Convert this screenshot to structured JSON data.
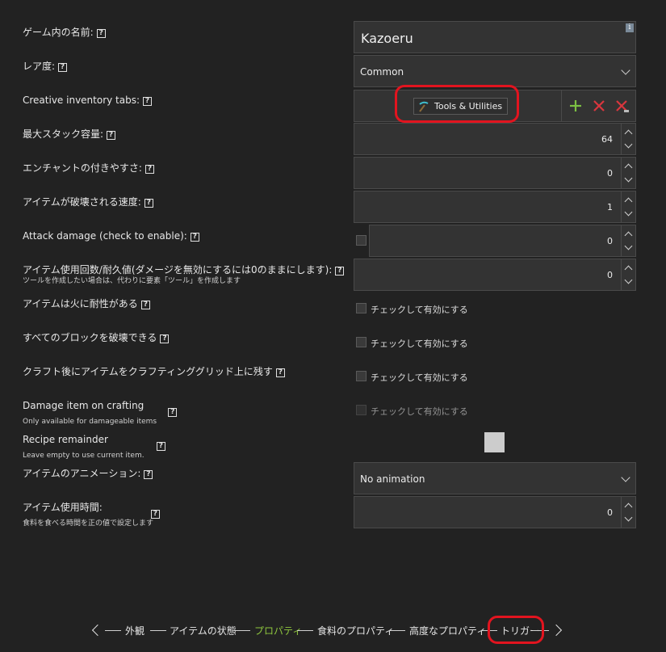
{
  "fields": {
    "name": {
      "label": "ゲーム内の名前:",
      "value": "Kazoeru",
      "info": "i"
    },
    "rarity": {
      "label": "レア度:",
      "value": "Common"
    },
    "creative_tabs": {
      "label": "Creative inventory tabs:",
      "tab": "Tools & Utilities"
    },
    "max_stack": {
      "label": "最大スタック容量:",
      "value": "64"
    },
    "enchantability": {
      "label": "エンチャントの付きやすさ:",
      "value": "0"
    },
    "destroy_speed": {
      "label": "アイテムが破壊される速度:",
      "value": "1"
    },
    "attack_damage": {
      "label": "Attack damage (check to enable):",
      "value": "0"
    },
    "durability": {
      "label": "アイテム使用回数/耐久値(ダメージを無効にするには0のままにします):",
      "sub": "ツールを作成したい場合は、代わりに要素「ツール」を作成します",
      "value": "0"
    },
    "fire_resistant": {
      "label": "アイテムは火に耐性がある",
      "check_text": "チェックして有効にする"
    },
    "destroy_any_block": {
      "label": "すべてのブロックを破壊できる",
      "check_text": "チェックして有効にする"
    },
    "stay_in_grid": {
      "label": "クラフト後にアイテムをクラフティンググリッド上に残す",
      "check_text": "チェックして有効にする"
    },
    "damage_on_crafting": {
      "label": "Damage item on crafting",
      "sub": "Only available for damageable items",
      "check_text": "チェックして有効にする"
    },
    "recipe_remainder": {
      "label": "Recipe remainder",
      "sub": "Leave empty to use current item."
    },
    "animation": {
      "label": "アイテムのアニメーション:",
      "value": "No animation"
    },
    "use_duration": {
      "label": "アイテム使用時間:",
      "sub": "食料を食べる時間を正の値で設定します",
      "value": "0"
    }
  },
  "help_mark": "?",
  "nav": {
    "items": [
      "外観",
      "アイテムの状態",
      "プロパティ",
      "食料のプロパティ",
      "高度なプロパティ",
      "トリガー"
    ],
    "active_index": 2,
    "active_color": "#8fc73e"
  },
  "icons": {
    "tab_icon": "pickaxe-icon",
    "add": "plus-icon",
    "remove": "x-icon",
    "remove_all": "x-all-icon"
  },
  "colors": {
    "add": "#7cc043",
    "remove": "#d9363e",
    "highlight": "#e2141f"
  }
}
